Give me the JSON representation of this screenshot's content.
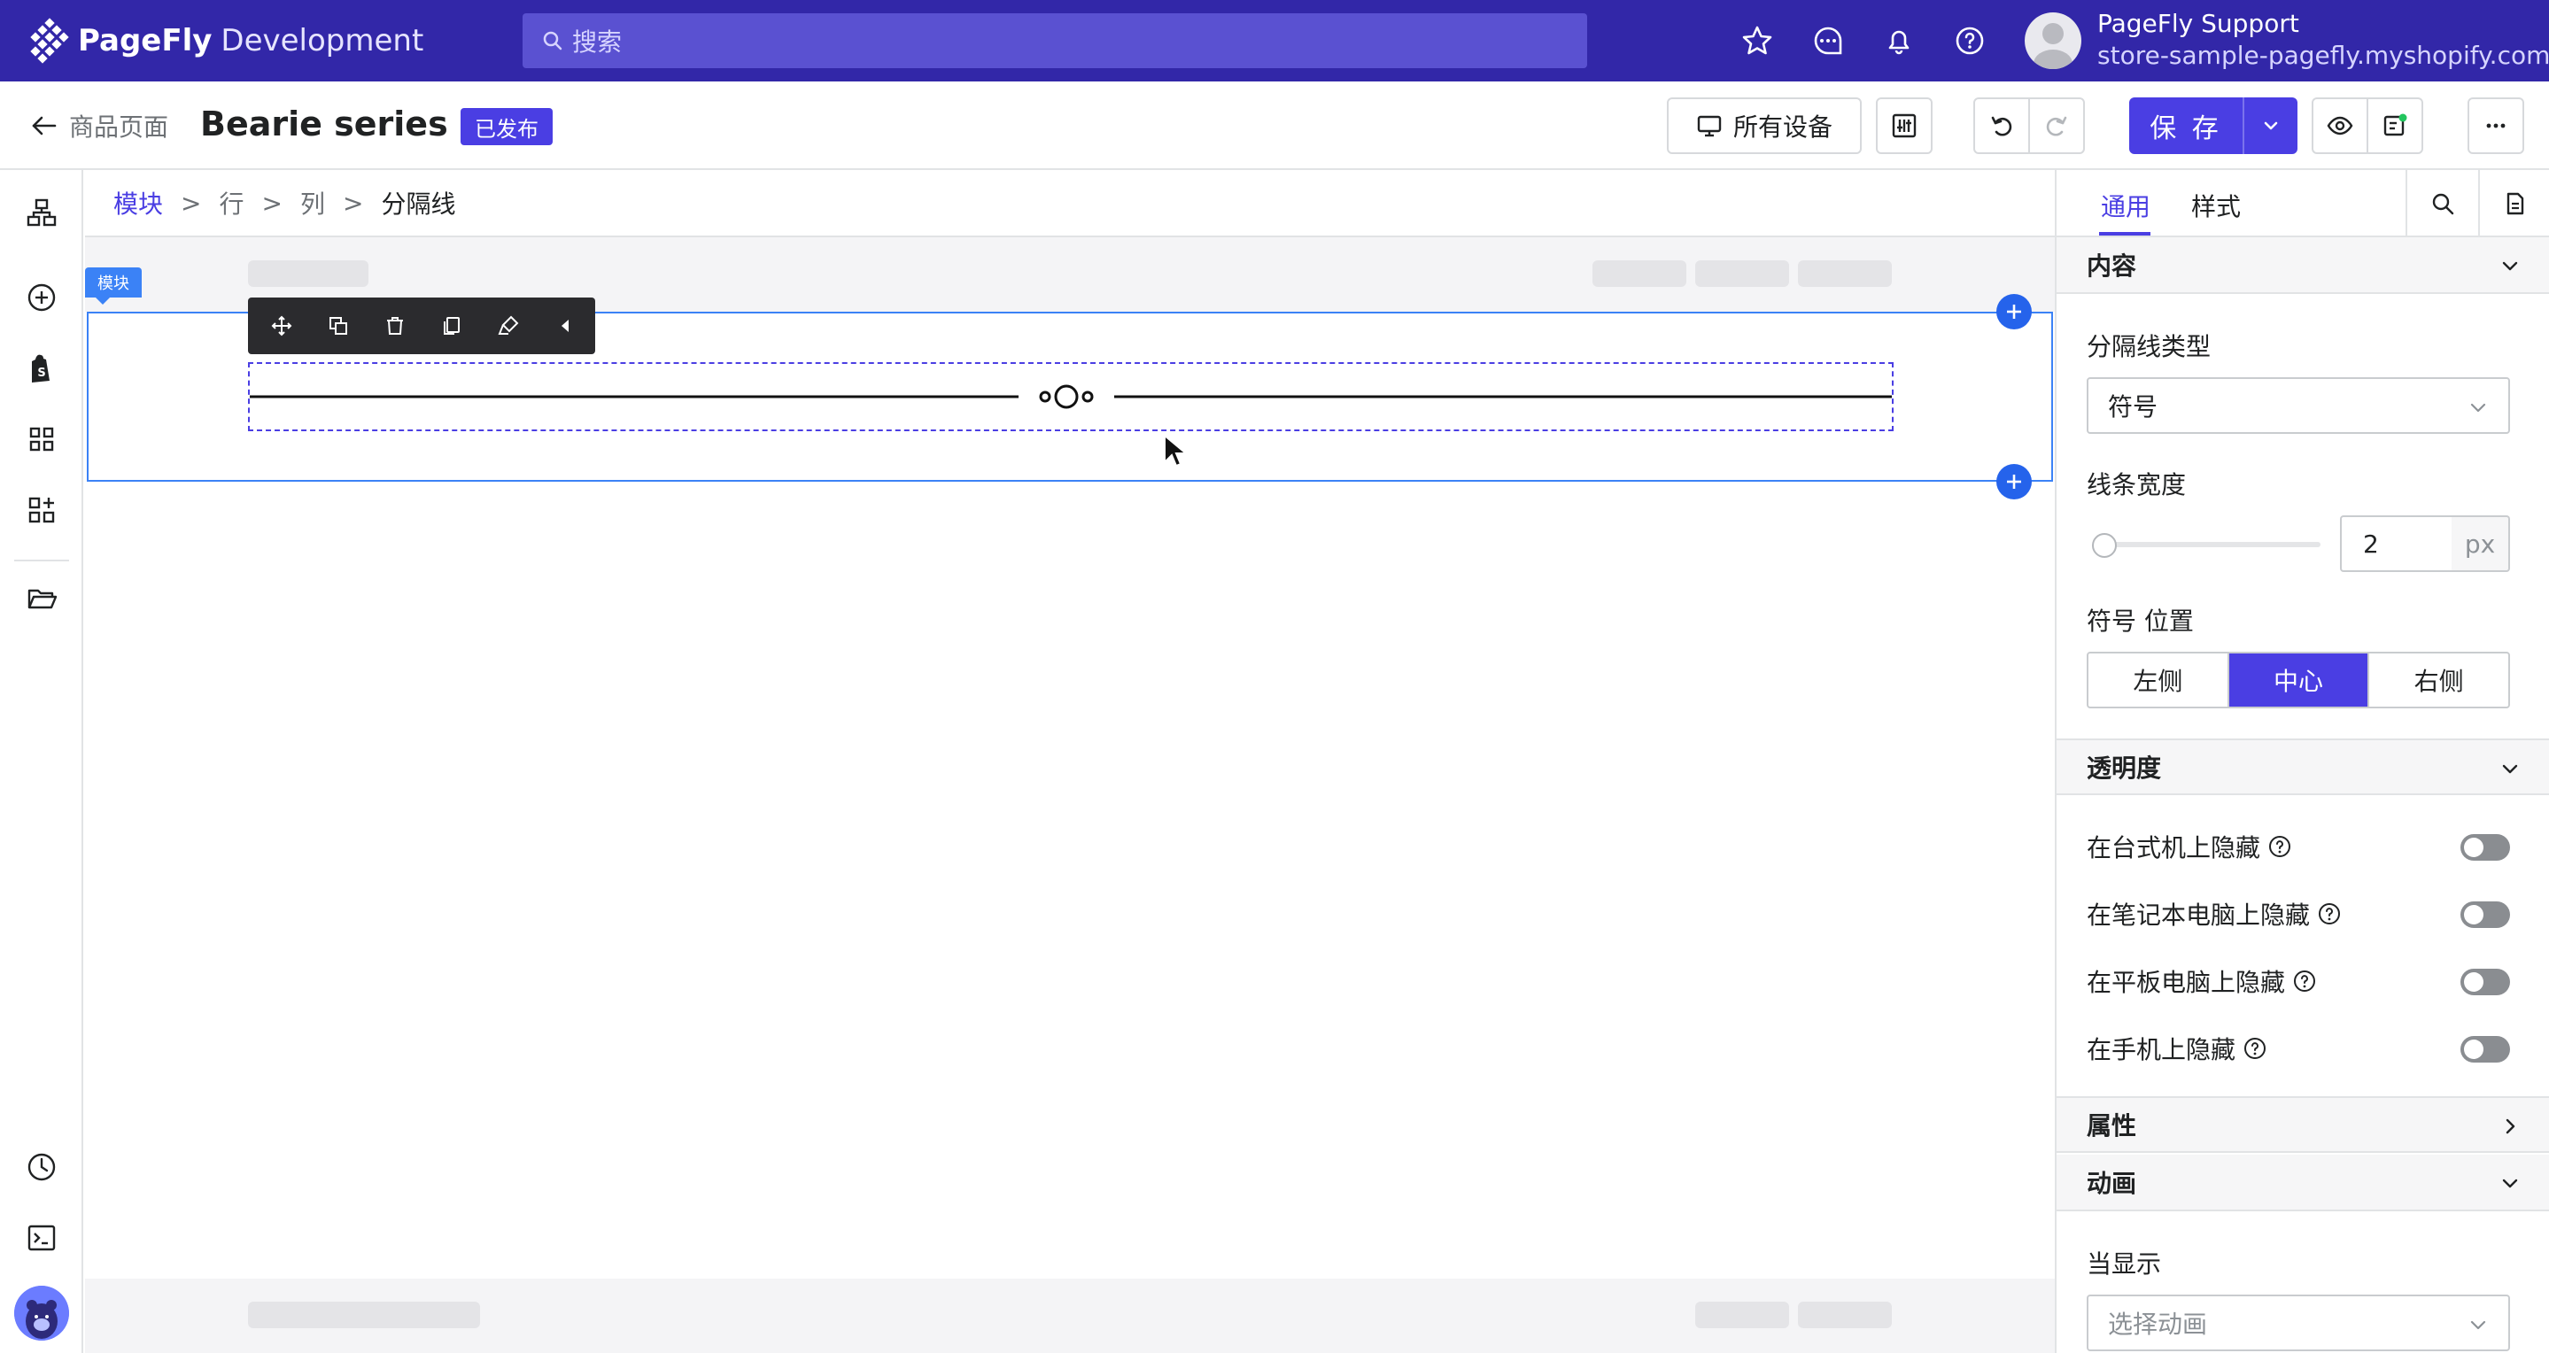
{
  "topbar": {
    "brand_name": "PageFly",
    "brand_env": "Development",
    "search_placeholder": "搜索",
    "account_name": "PageFly Support",
    "account_store": "store-sample-pagefly.myshopify.com",
    "accent_color": "#3227a8"
  },
  "header": {
    "back_label": "商品页面",
    "page_title": "Bearie series",
    "status_badge": "已发布",
    "device_label": "所有设备",
    "save_label": "保 存"
  },
  "breadcrumb": [
    "模块",
    "行",
    "列",
    "分隔线"
  ],
  "canvas": {
    "section_tag": "模块",
    "toolbar_icons": [
      "move-icon",
      "duplicate-icon",
      "delete-icon",
      "copy-icon",
      "paint-icon",
      "collapse-left-icon"
    ]
  },
  "panel": {
    "tabs": [
      "通用",
      "样式"
    ],
    "content_section": "内容",
    "divider_type_label": "分隔线类型",
    "divider_type_value": "符号",
    "line_width_label": "线条宽度",
    "line_width_value": "2",
    "line_width_unit": "px",
    "symbol_position_label": "符号 位置",
    "positions": [
      "左侧",
      "中心",
      "右侧"
    ],
    "active_position": "中心",
    "opacity_section": "透明度",
    "hide_options": [
      "在台式机上隐藏",
      "在笔记本电脑上隐藏",
      "在平板电脑上隐藏",
      "在手机上隐藏"
    ],
    "attributes_section": "属性",
    "animation_section": "动画",
    "when_visible_label": "当显示",
    "animation_placeholder": "选择动画"
  },
  "icons": {
    "left_sidebar": [
      "sitemap-icon",
      "add-circle-icon",
      "shopify-icon",
      "grid-icon",
      "apps-icon",
      "folder-icon",
      "history-icon",
      "terminal-icon"
    ],
    "top_right": [
      "star-icon",
      "chat-icon",
      "bell-icon",
      "help-icon"
    ]
  }
}
